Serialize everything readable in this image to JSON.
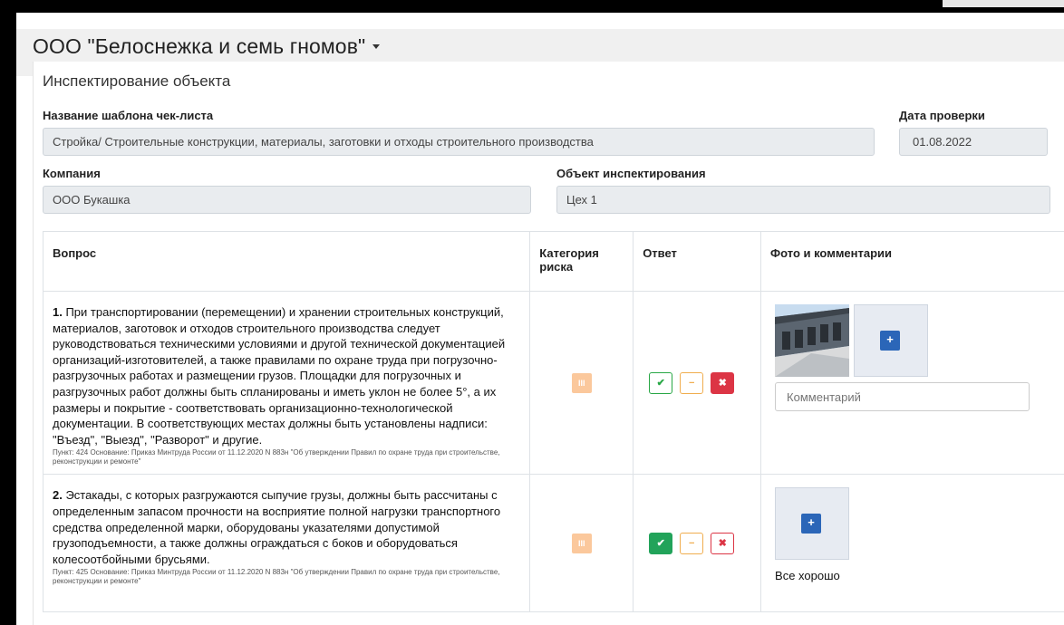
{
  "header": {
    "org_name": "ООО \"Белоснежка и семь гномов\""
  },
  "page": {
    "title": "Инспектирование объекта"
  },
  "form": {
    "template_label": "Название шаблона чек-листа",
    "template_value": "Стройка/ Строительные конструкции, материалы, заготовки и отходы строительного производства",
    "date_label": "Дата проверки",
    "date_value": "01.08.2022",
    "company_label": "Компания",
    "company_value": "ООО Букашка",
    "object_label": "Объект инспектирования",
    "object_value": "Цех 1"
  },
  "table": {
    "headers": {
      "question": "Вопрос",
      "risk_line1": "Категория",
      "risk_line2": "риска",
      "answer": "Ответ",
      "photos": "Фото и комментарии"
    },
    "rows": [
      {
        "num": "1.",
        "text": " При транспортировании (перемещении) и хранении строительных конструкций, материалов, заготовок и отходов строительного производства следует руководствоваться техническими условиями и другой технической документацией организаций-изготовителей, а также правилами по охране труда при погрузочно-разгрузочных работах и размещении грузов. Площадки для погрузочных и разгрузочных работ должны быть спланированы и иметь уклон не более 5°, а их размеры и покрытие - соответствовать организационно-технологической документации. В соответствующих местах должны быть установлены надписи: \"Въезд\", \"Выезд\", \"Разворот\" и другие.",
        "basis": "Пункт: 424 Основание: Приказ Минтруда России от 11.12.2020 N 883н \"Об утверждении Правил по охране труда при строительстве, реконструкции и ремонте\"",
        "risk": "III",
        "comment_placeholder": "Комментарий",
        "answer_selected": "no"
      },
      {
        "num": "2.",
        "text": " Эстакады, с которых разгружаются сыпучие грузы, должны быть рассчитаны с определенным запасом прочности на восприятие полной нагрузки транспортного средства определенной марки, оборудованы указателями допустимой грузоподъемности, а также должны ограждаться с боков и оборудоваться колесоотбойными брусьями.",
        "basis": "Пункт: 425 Основание: Приказ Минтруда России от 11.12.2020 N 883н \"Об утверждении Правил по охране труда при строительстве, реконструкции и ремонте\"",
        "risk": "III",
        "comment": "Все хорошо",
        "answer_selected": "ok"
      }
    ]
  },
  "icons": {
    "ok": "check-icon",
    "na": "minus-icon",
    "no": "cross-icon",
    "add": "plus-icon"
  },
  "glyphs": {
    "ok": "✔",
    "na": "−",
    "no": "✖",
    "add": "+"
  },
  "colors": {
    "ok": "#22a35a",
    "na": "#f0ad4e",
    "no": "#dc3545",
    "risk": "#fbc89c",
    "add": "#2b66b8"
  }
}
